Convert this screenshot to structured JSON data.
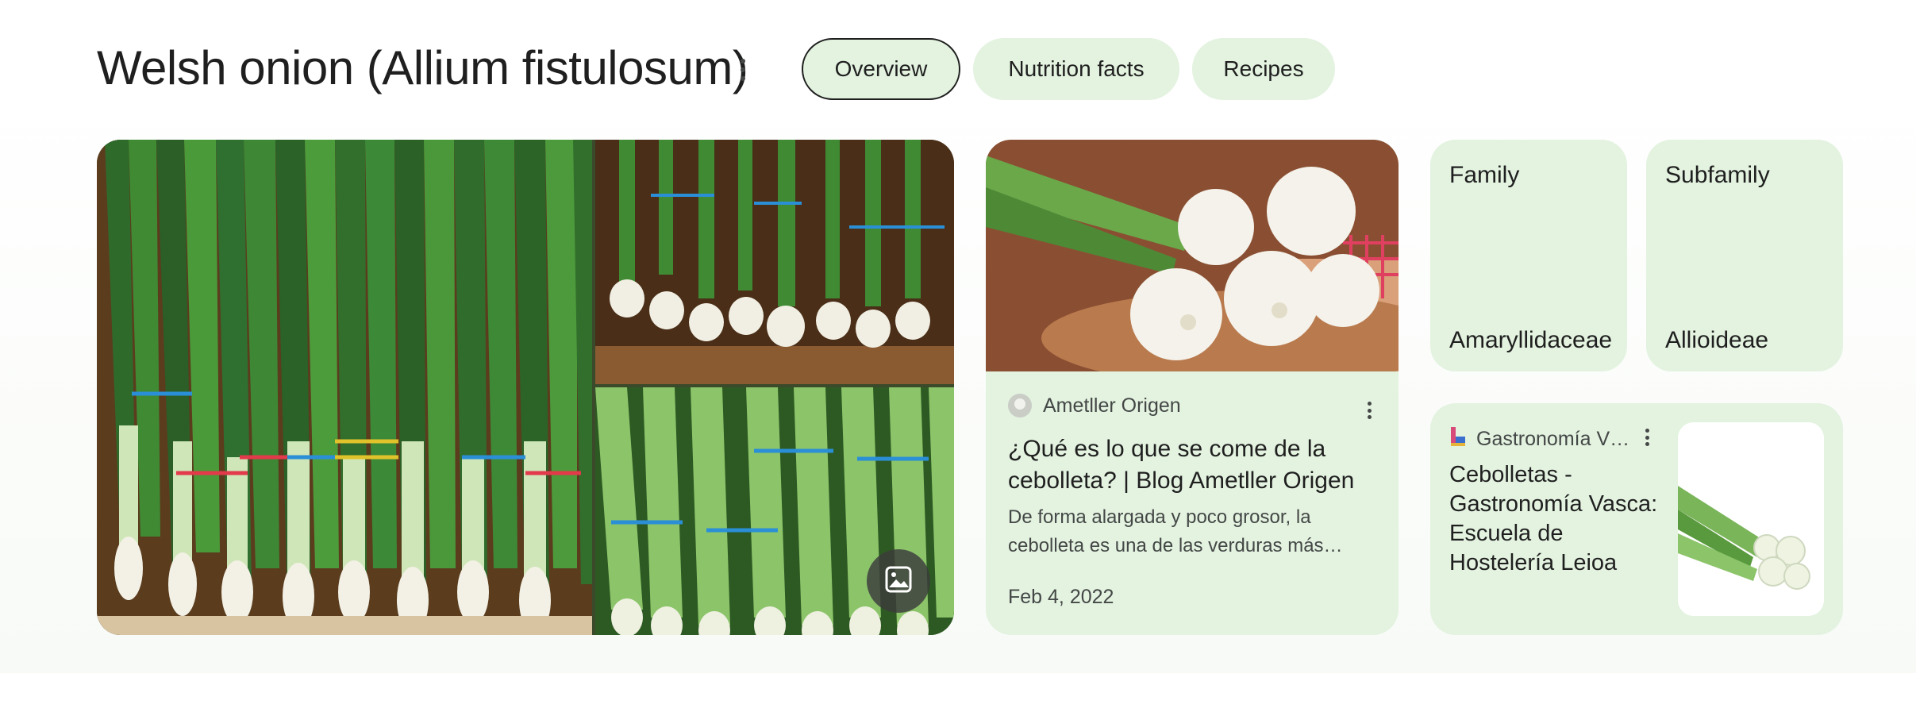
{
  "header": {
    "title": "Welsh onion (Allium fistulosum)",
    "tabs": [
      {
        "label": "Overview",
        "active": true
      },
      {
        "label": "Nutrition facts",
        "active": false
      },
      {
        "label": "Recipes",
        "active": false
      }
    ]
  },
  "gallery": {
    "images": [
      "scallion-bunches-main",
      "scallion-basket",
      "scallion-bunches"
    ],
    "button_icon": "image-gallery-icon"
  },
  "article": {
    "source": "Ametller Origen",
    "title_line1": "¿Qué es lo que se come de la",
    "title_line2": "cebolleta? | Blog Ametller Origen",
    "snippet_line1": "De forma alargada y poco grosor, la",
    "snippet_line2": "cebolleta es una de las verduras más…",
    "date": "Feb 4, 2022"
  },
  "facts": [
    {
      "label": "Family",
      "value": "Amaryllidaceae"
    },
    {
      "label": "Subfamily",
      "value": "Allioideae"
    }
  ],
  "related": {
    "source": "Gastronomía V…",
    "title_lines": [
      "Cebolletas -",
      "Gastronomía Vasca:",
      "Escuela de",
      "Hostelería Leioa"
    ]
  },
  "colors": {
    "chip_bg": "#e3f3e0",
    "card_bg": "#e3f3e0",
    "text": "#1f1f1f",
    "muted": "#444746"
  }
}
